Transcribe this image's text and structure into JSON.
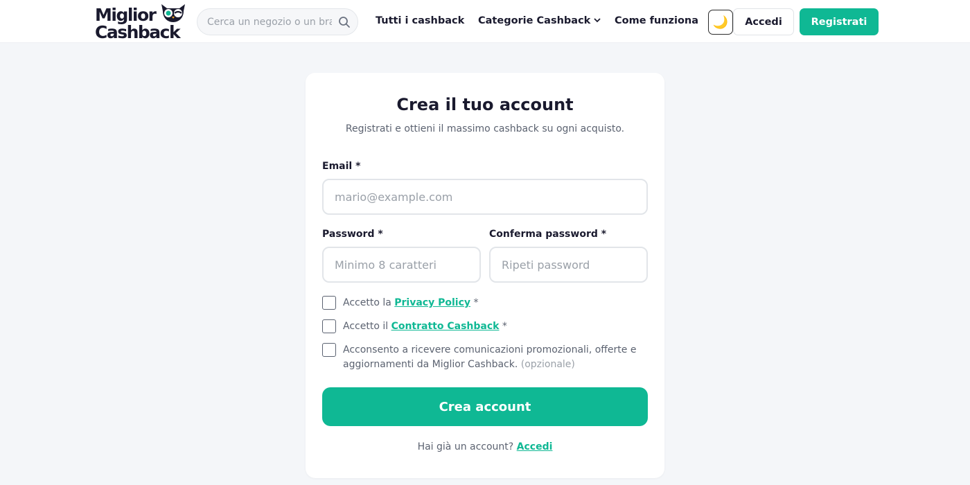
{
  "header": {
    "logo_line1": "Miglior",
    "logo_line2": "Cashback",
    "search_placeholder": "Cerca un negozio o un brand",
    "nav": {
      "all_cashback": "Tutti i cashback",
      "categories": "Categorie Cashback",
      "how_it_works": "Come funziona"
    },
    "theme_icon": "🌙",
    "login_label": "Accedi",
    "register_label": "Registrati"
  },
  "form": {
    "title": "Crea il tuo account",
    "subtitle": "Registrati e ottieni il massimo cashback su ogni acquisto.",
    "email_label": "Email *",
    "email_placeholder": "mario@example.com",
    "password_label": "Password *",
    "password_placeholder": "Minimo 8 caratteri",
    "confirm_label": "Conferma password *",
    "confirm_placeholder": "Ripeti password",
    "privacy_prefix": "Accetto la ",
    "privacy_link": "Privacy Policy",
    "privacy_suffix": " *",
    "contract_prefix": "Accetto il ",
    "contract_link": "Contratto Cashback",
    "contract_suffix": " *",
    "marketing_text": "Acconsento a ricevere comunicazioni promozionali, offerte e aggiornamenti da Miglior Cashback.",
    "marketing_optional": "(opzionale)",
    "submit_label": "Crea account",
    "footer_prefix": "Hai già un account? ",
    "footer_link": "Accedi"
  },
  "colors": {
    "accent": "#0fb894",
    "text_dark": "#1a1a2e",
    "text_muted": "#5b6270",
    "background": "#f4f6f9"
  },
  "icons": {
    "logo_mascot": "owl-icon",
    "search": "search-icon",
    "theme": "moon-icon",
    "dropdown": "chevron-down-icon"
  }
}
